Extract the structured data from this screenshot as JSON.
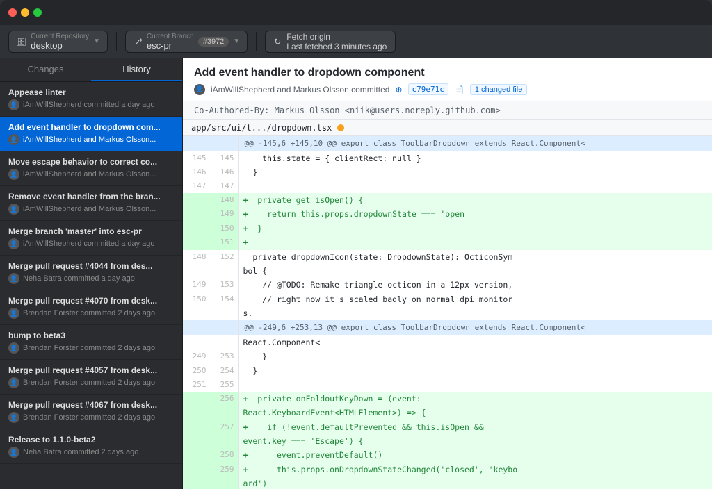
{
  "titlebar": {
    "traffic_lights": [
      "red",
      "yellow",
      "green"
    ]
  },
  "toolbar": {
    "repo_label": "Current Repository",
    "repo_name": "desktop",
    "branch_label": "Current Branch",
    "branch_name": "esc-pr",
    "branch_pr": "#3972",
    "fetch_label": "Fetch origin",
    "fetch_sub": "Last fetched 3 minutes ago"
  },
  "sidebar": {
    "tab_changes": "Changes",
    "tab_history": "History",
    "commits": [
      {
        "title": "Appease linter",
        "author": "iAmWillShepherd committed a day ago",
        "active": false
      },
      {
        "title": "Add event handler to dropdown com...",
        "author": "iAmWillShepherd and Markus Olsson...",
        "active": true
      },
      {
        "title": "Move escape behavior to correct co...",
        "author": "iAmWillShepherd and Markus Olsson...",
        "active": false
      },
      {
        "title": "Remove event handler from the bran...",
        "author": "iAmWillShepherd and Markus Olsson...",
        "active": false
      },
      {
        "title": "Merge branch 'master' into esc-pr",
        "author": "iAmWillShepherd committed a day ago",
        "active": false
      },
      {
        "title": "Merge pull request #4044 from des...",
        "author": "Neha Batra committed a day ago",
        "active": false
      },
      {
        "title": "Merge pull request #4070 from desk...",
        "author": "Brendan Forster committed 2 days ago",
        "active": false
      },
      {
        "title": "bump to beta3",
        "author": "Brendan Forster committed 2 days ago",
        "active": false
      },
      {
        "title": "Merge pull request #4057 from desk...",
        "author": "Brendan Forster committed 2 days ago",
        "active": false
      },
      {
        "title": "Merge pull request #4067 from desk...",
        "author": "Brendan Forster committed 2 days ago",
        "active": false
      },
      {
        "title": "Release to 1.1.0-beta2",
        "author": "Neha Batra committed 2 days ago",
        "active": false
      }
    ]
  },
  "content": {
    "commit_title": "Add event handler to dropdown component",
    "commit_author": "iAmWillShepherd and Markus Olsson committed",
    "commit_hash": "c79e71c",
    "changed_files": "1 changed file",
    "co_author": "Co-Authored-By: Markus Olsson <niik@users.noreply.github.com>",
    "file_path": "app/src/ui/t.../dropdown.tsx",
    "diff_hunk1": "@@ -145,6 +145,10 @@ export class ToolbarDropdown extends React.Component<",
    "diff_lines": [
      {
        "type": "context",
        "old": "145",
        "new": "145",
        "code": "    this.state = { clientRect: null }"
      },
      {
        "type": "context",
        "old": "146",
        "new": "146",
        "code": "  }"
      },
      {
        "type": "context",
        "old": "147",
        "new": "147",
        "code": ""
      },
      {
        "type": "added",
        "old": "",
        "new": "148",
        "code": "+  private get isOpen() {"
      },
      {
        "type": "added",
        "old": "",
        "new": "149",
        "code": "+    return this.props.dropdownState === 'open'"
      },
      {
        "type": "added",
        "old": "",
        "new": "150",
        "code": "+  }"
      },
      {
        "type": "added",
        "old": "",
        "new": "151",
        "code": "+"
      },
      {
        "type": "context",
        "old": "148",
        "new": "152",
        "code": "  private dropdownIcon(state: DropdownState): OcticonSym"
      },
      {
        "type": "context-cont",
        "old": "",
        "new": "",
        "code": "bol {"
      },
      {
        "type": "context",
        "old": "149",
        "new": "153",
        "code": "    // @TODO: Remake triangle octicon in a 12px version,"
      },
      {
        "type": "context",
        "old": "150",
        "new": "154",
        "code": "    // right now it's scaled badly on normal dpi monitor"
      },
      {
        "type": "context-cont2",
        "old": "",
        "new": "",
        "code": "s."
      }
    ],
    "diff_hunk2": "@@ -249,6 +253,13 @@ export class ToolbarDropdown extends React.Component<",
    "diff_lines2": [
      {
        "type": "context",
        "old": "249",
        "new": "253",
        "code": "    }"
      },
      {
        "type": "context",
        "old": "250",
        "new": "254",
        "code": "  }"
      },
      {
        "type": "context",
        "old": "251",
        "new": "255",
        "code": ""
      },
      {
        "type": "added",
        "old": "",
        "new": "256",
        "code": "+  private onFoldoutKeyDown = (event:"
      },
      {
        "type": "added-cont",
        "old": "",
        "new": "",
        "code": "React.KeyboardEvent<HTMLElement>) => {"
      },
      {
        "type": "added",
        "old": "",
        "new": "257",
        "code": "+    if (!event.defaultPrevented && this.isOpen &&"
      },
      {
        "type": "added-cont2",
        "old": "",
        "new": "",
        "code": "event.key === 'Escape') {"
      },
      {
        "type": "added",
        "old": "",
        "new": "258",
        "code": "+      event.preventDefault()"
      },
      {
        "type": "added",
        "old": "",
        "new": "259",
        "code": "+      this.props.onDropdownStateChanged('closed', 'keybo"
      },
      {
        "type": "added-cont3",
        "old": "",
        "new": "",
        "code": "ard')"
      }
    ]
  }
}
